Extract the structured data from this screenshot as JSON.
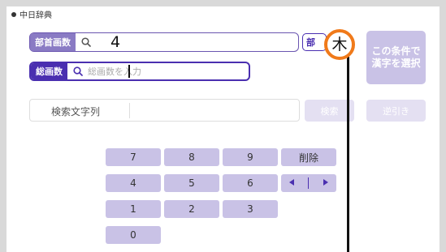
{
  "header": {
    "title": "中日辞典"
  },
  "search": {
    "radical_strokes_label": "部首画数",
    "radical_strokes_value": "4",
    "total_strokes_label": "総画数",
    "total_strokes_placeholder": "総画数を入力",
    "radical_button_partial": "部",
    "select_button_line1": "この条件で",
    "select_button_line2": "漢字を選択"
  },
  "search_string": {
    "label": "検索文字列",
    "search_button": "検索",
    "reverse_button": "逆引き"
  },
  "keypad": {
    "k7": "7",
    "k8": "8",
    "k9": "9",
    "delete": "削除",
    "k4": "4",
    "k5": "5",
    "k6": "6",
    "k1": "1",
    "k2": "2",
    "k3": "3",
    "k0": "0"
  },
  "overlay": {
    "kanji": "木"
  },
  "colors": {
    "accent": "#4a2fb0",
    "key_bg": "#c9c2e6",
    "overlay_ring": "#f07a1a"
  }
}
